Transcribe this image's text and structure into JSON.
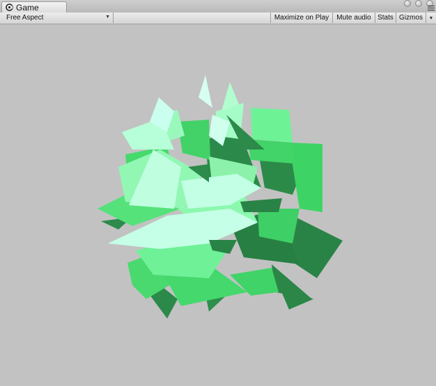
{
  "tab": {
    "label": "Game",
    "icon": "unity-game-icon"
  },
  "window_controls": [
    "close-dot",
    "minimize-dot",
    "maximize-dot"
  ],
  "toolbar": {
    "aspect": "Free Aspect",
    "maximize_on_play": "Maximize on Play",
    "mute_audio": "Mute audio",
    "stats": "Stats",
    "gizmos": "Gizmos"
  },
  "viewport": {
    "background": "#c2c2c2",
    "palette": [
      "#2a8346",
      "#3fd066",
      "#6ef296",
      "#a8ffc5",
      "#c6ffe7"
    ]
  }
}
